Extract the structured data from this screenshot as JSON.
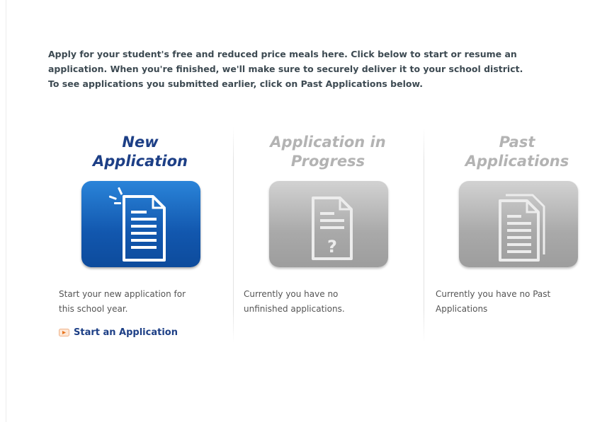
{
  "intro": {
    "line1": "Apply for your student's free and reduced price meals here. Click below to start or resume an",
    "line2": "application. When you're finished, we'll make sure to securely deliver it to your school district.",
    "line3": "To see applications you submitted earlier, click on Past Applications below."
  },
  "columns": {
    "new": {
      "title_line1": "New",
      "title_line2": "Application",
      "desc_line1": "Start your new application for",
      "desc_line2": "this school year.",
      "link_label": "Start an Application",
      "icon": "new-document-icon"
    },
    "progress": {
      "title_line1": "Application in",
      "title_line2": "Progress",
      "desc_line1": "Currently you have no",
      "desc_line2": "unfinished applications.",
      "icon": "question-document-icon"
    },
    "past": {
      "title_line1": "Past",
      "title_line2": "Applications",
      "desc_line1": "Currently you have no Past",
      "desc_line2": "Applications",
      "icon": "stacked-documents-icon"
    }
  },
  "colors": {
    "active_title": "#1d3f86",
    "inactive_title": "#b3b3b3",
    "active_tile": "#1257ae",
    "inactive_tile": "#a9a9a9",
    "link": "#1d3f86",
    "link_arrow": "#e8741d"
  }
}
